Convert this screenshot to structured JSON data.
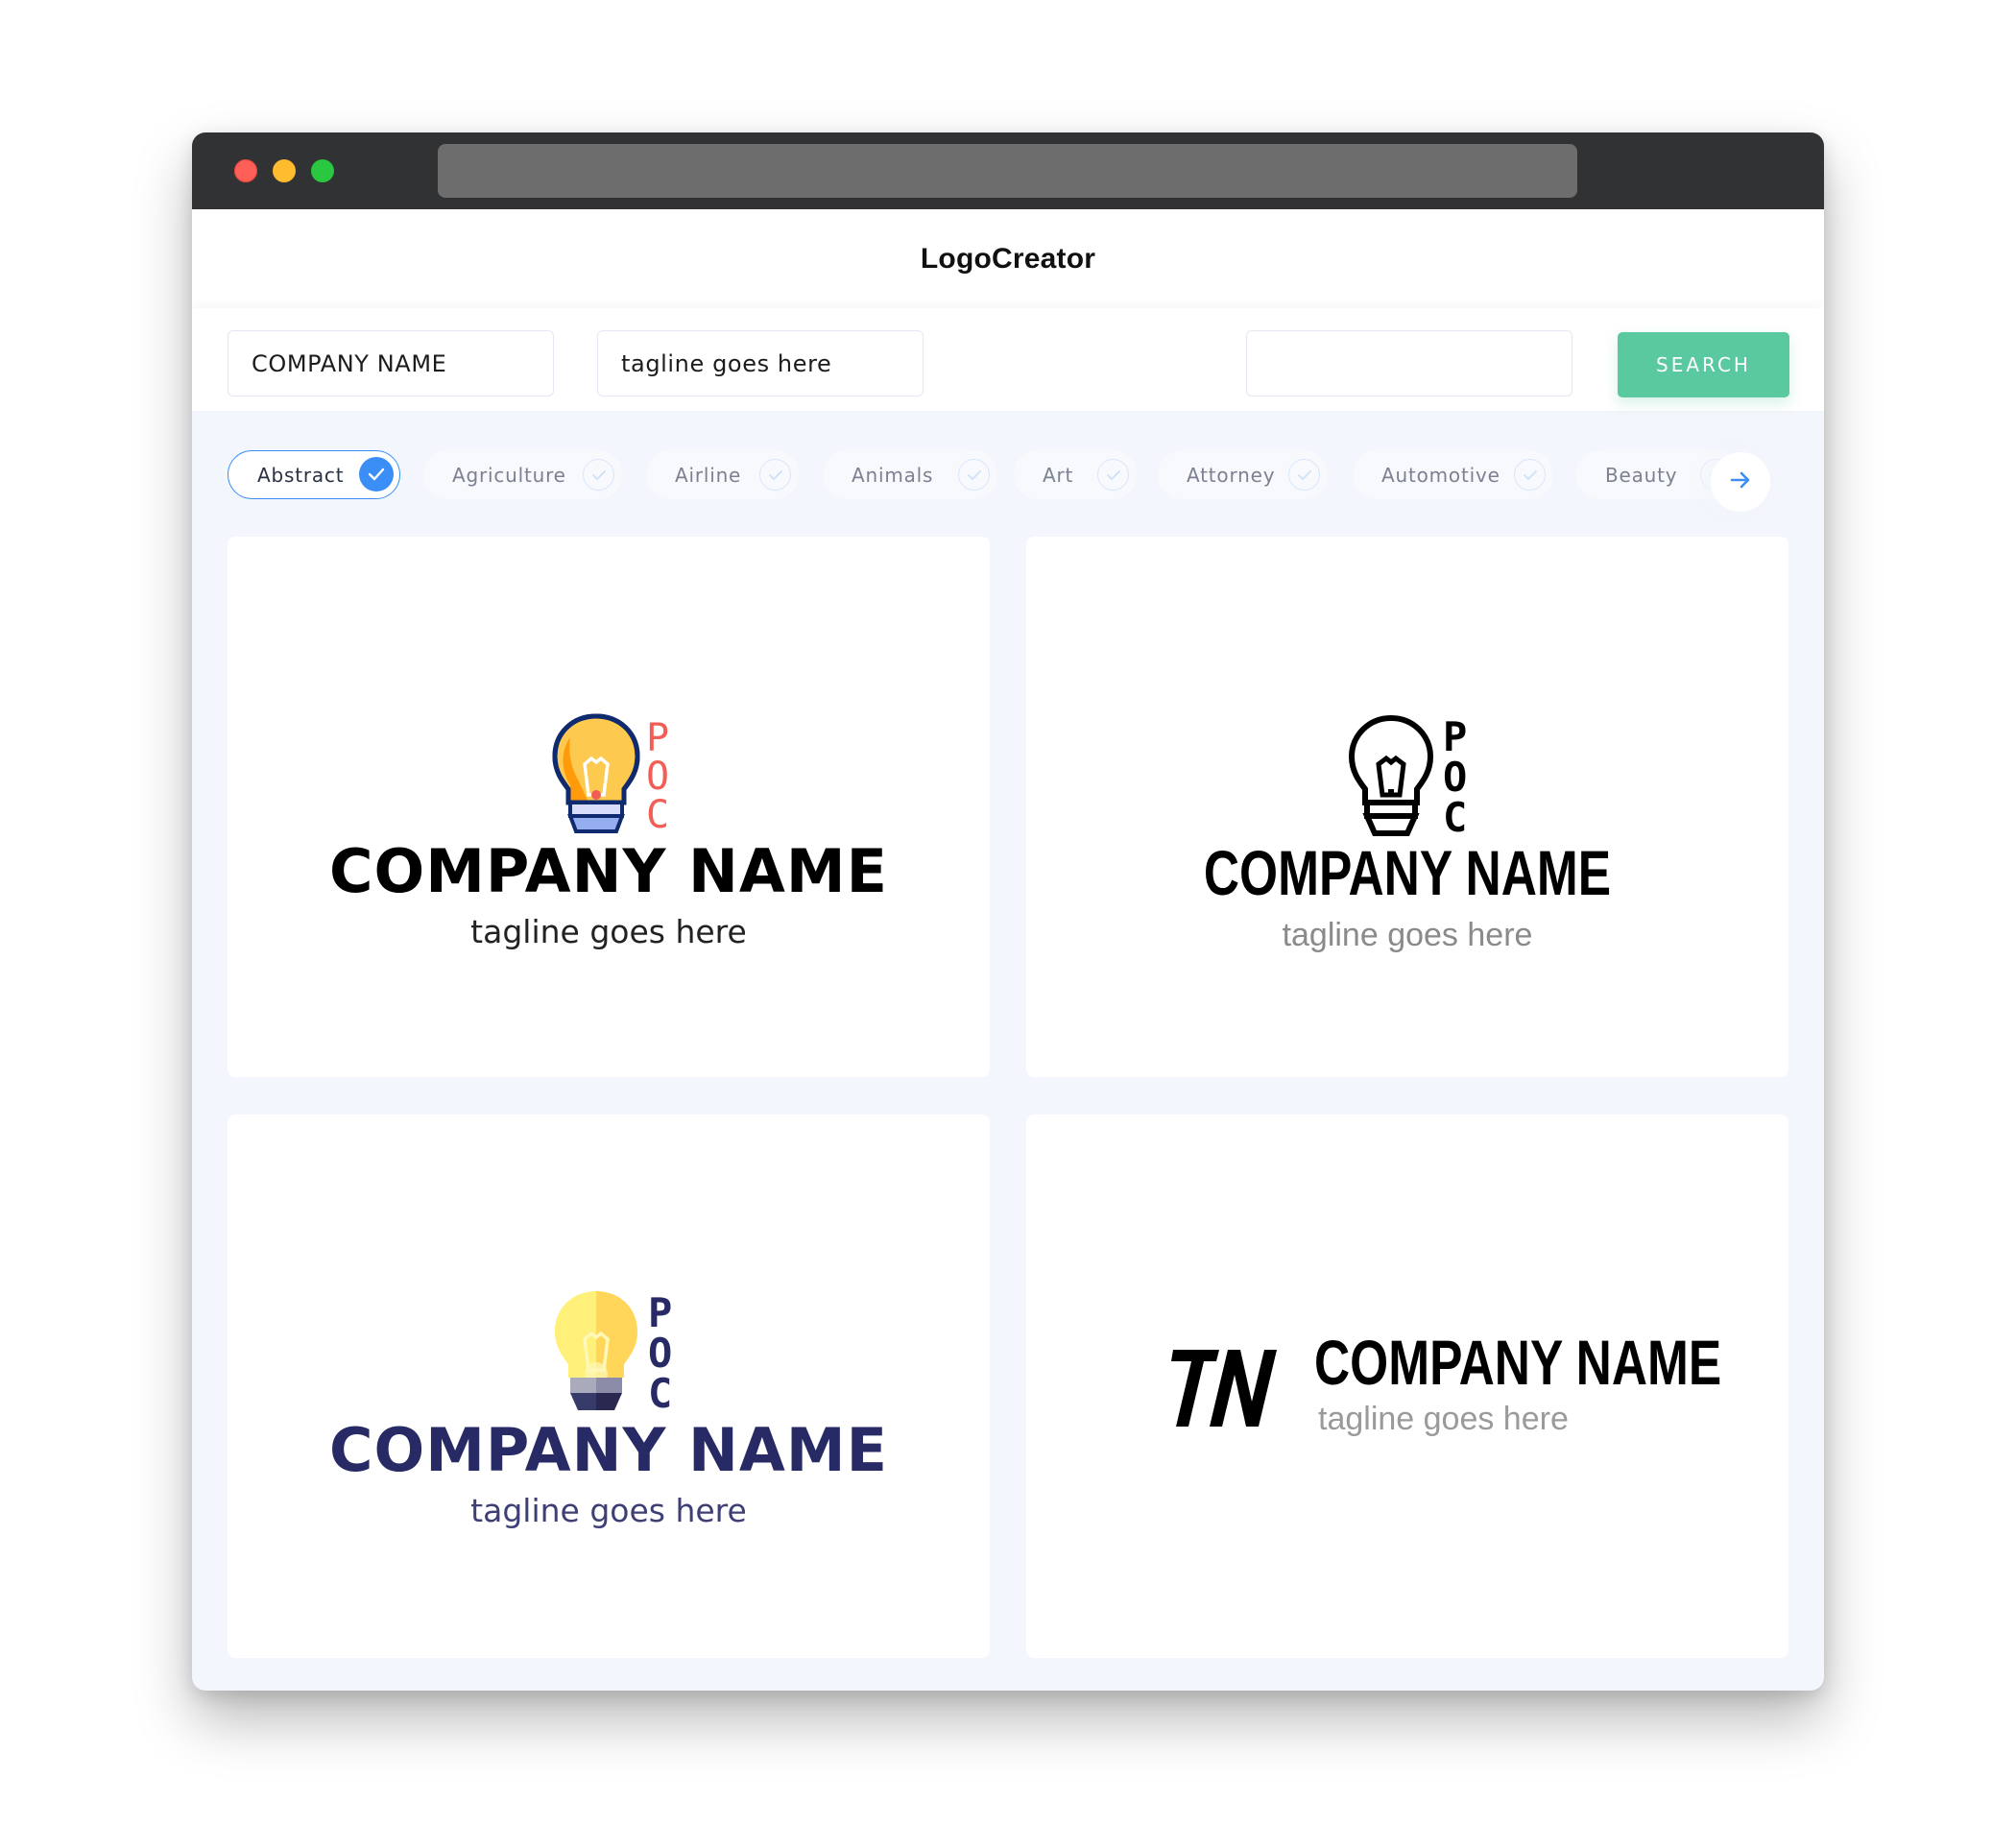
{
  "window": {
    "traffic_lights": [
      "close",
      "minimize",
      "maximize"
    ],
    "address_bar": ""
  },
  "header": {
    "brand": "LogoCreator"
  },
  "search": {
    "company_name_value": "COMPANY NAME",
    "tagline_value": "tagline goes here",
    "keyword_value": "",
    "search_button_label": "SEARCH"
  },
  "categories": {
    "items": [
      {
        "label": "Abstract",
        "selected": true
      },
      {
        "label": "Agriculture",
        "selected": false
      },
      {
        "label": "Airline",
        "selected": false
      },
      {
        "label": "Animals",
        "selected": false
      },
      {
        "label": "Art",
        "selected": false
      },
      {
        "label": "Attorney",
        "selected": false
      },
      {
        "label": "Automotive",
        "selected": false
      },
      {
        "label": "Beauty",
        "selected": false
      }
    ],
    "next_icon": "arrow-right-icon"
  },
  "logos": [
    {
      "style": "colored-lightbulb",
      "icon": "lightbulb-icon",
      "monogram_letters": [
        "P",
        "O",
        "C"
      ],
      "company_name": "COMPANY NAME",
      "tagline": "tagline goes here",
      "colors": {
        "name": "#000000",
        "tagline": "#222222",
        "monogram": "#f25e56",
        "bulb": "#fdc94f",
        "bulb_shade": "#ff9a0b",
        "outline": "#0f2a6e",
        "base": "#d7dcfb",
        "base2": "#94aef0"
      }
    },
    {
      "style": "outline-lightbulb",
      "icon": "lightbulb-outline-icon",
      "monogram_letters": [
        "P",
        "O",
        "C"
      ],
      "company_name": "COMPANY NAME",
      "tagline": "tagline goes here",
      "colors": {
        "name": "#000000",
        "tagline": "#8a8a8a",
        "monogram": "#000000"
      }
    },
    {
      "style": "flat-lightbulb",
      "icon": "lightbulb-flat-icon",
      "monogram_letters": [
        "P",
        "O",
        "C"
      ],
      "company_name": "COMPANY NAME",
      "tagline": "tagline goes here",
      "colors": {
        "name": "#272a64",
        "tagline": "#3d3f75",
        "monogram": "#272a64",
        "bulb_left": "#fff07a",
        "bulb_right": "#ffd55a",
        "base_left": "#a9aabb",
        "base_right": "#8c8ca8",
        "tip_left": "#373b6a",
        "tip_right": "#2a2850"
      }
    },
    {
      "style": "monogram-tn",
      "icon": "tn-monogram-icon",
      "monogram_text": "TN",
      "company_name": "COMPANY NAME",
      "tagline": "tagline goes here",
      "colors": {
        "name": "#000000",
        "tagline": "#9a9a9a",
        "monogram": "#000000"
      }
    }
  ],
  "theme": {
    "accent": "#3a8ef6",
    "search_button": "#5ac9a0",
    "titlebar": "#313234",
    "page_bg": "#f3f6fc"
  }
}
